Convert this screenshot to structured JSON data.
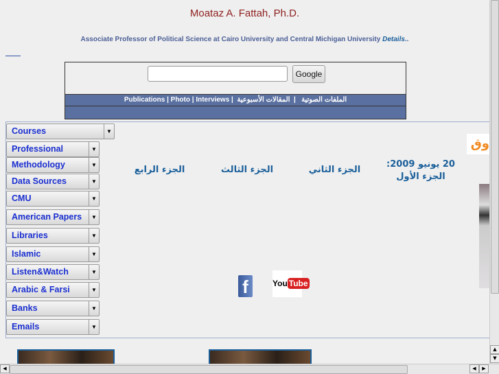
{
  "header": {
    "title": "Moataz A. Fattah, Ph.D.",
    "subtitle": "Associate Professor of Political Science at Cairo University and Central Michigan University ",
    "details_link": "Details",
    "details_suffix": ".."
  },
  "search": {
    "value": "",
    "placeholder": "",
    "button_label": "Google"
  },
  "nav": {
    "items": [
      "Publications",
      "Photo",
      "Interviews",
      "الملفات الصوتية",
      "المقالات الأسبوعية"
    ],
    "separator": "|"
  },
  "sidebar": {
    "selects": [
      "Courses",
      "Professional",
      "Methodology",
      "Data Sources",
      "CMU",
      "American Papers",
      "Libraries",
      "Islamic",
      "Listen&Watch",
      "Arabic & Farsi",
      "Banks",
      "Emails"
    ]
  },
  "main": {
    "parts": [
      "20 يونيو 2009: الجزء الأول",
      "الجزء الثاني",
      "الجزء الثالث",
      "الجزء الرابع"
    ],
    "side_banner_text": "وق"
  },
  "social": {
    "icons": [
      "facebook-icon",
      "youtube-icon"
    ],
    "youtube_text_you": "You",
    "youtube_text_tube": "Tube"
  },
  "colors": {
    "title": "#8e1e1e",
    "subtitle": "#4d6198",
    "nav_bar": "#5a70a0",
    "select_text": "#1a2fd0",
    "arabic_link": "#1a5f9a"
  }
}
